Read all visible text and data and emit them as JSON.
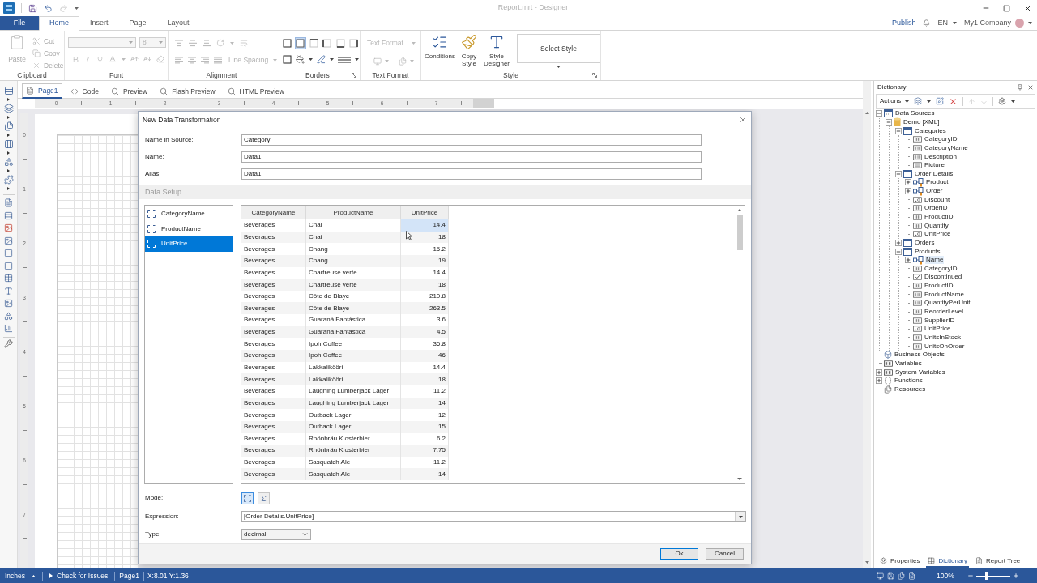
{
  "window": {
    "title": "Report.mrt - Designer"
  },
  "ribbon_tabs": [
    {
      "label": "File",
      "kind": "file",
      "selected": false
    },
    {
      "label": "Home",
      "kind": "tab",
      "selected": true
    },
    {
      "label": "Insert",
      "kind": "tab",
      "selected": false
    },
    {
      "label": "Page",
      "kind": "tab",
      "selected": false
    },
    {
      "label": "Layout",
      "kind": "tab",
      "selected": false
    }
  ],
  "account": {
    "publish": "Publish",
    "language": "EN",
    "company": "My1 Company"
  },
  "ribbon": {
    "clipboard": {
      "label": "Clipboard",
      "paste": {
        "label": "Paste",
        "disabled": true
      },
      "items": [
        {
          "label": "Cut",
          "kind": "cut",
          "disabled": true
        },
        {
          "label": "Copy",
          "kind": "copy",
          "disabled": true
        },
        {
          "label": "Delete",
          "kind": "delete",
          "disabled": true
        }
      ]
    },
    "font": {
      "label": "Font",
      "size": "8",
      "disabled": true
    },
    "alignment": {
      "label": "Alignment",
      "line_spacing": "Line Spacing",
      "disabled": true
    },
    "borders": {
      "label": "Borders",
      "buttons": [
        {
          "kind": "all",
          "selected": false
        },
        {
          "kind": "none",
          "selected": true
        },
        {
          "kind": "top",
          "selected": false
        },
        {
          "kind": "left",
          "selected": false
        },
        {
          "kind": "bottom",
          "selected": false
        },
        {
          "kind": "right",
          "selected": false
        }
      ]
    },
    "text_format": {
      "label": "Text Format",
      "format": "Text Format",
      "disabled": true
    },
    "style": {
      "label": "Style",
      "buttons": [
        {
          "label": "Conditions",
          "kind": "conditions"
        },
        {
          "label": "Copy Style",
          "kind": "copy"
        },
        {
          "label": "Style Designer",
          "kind": "designer"
        }
      ],
      "select": "Select Style"
    }
  },
  "doc_tabs": [
    {
      "label": "Page1",
      "kind": "page",
      "selected": true
    },
    {
      "label": "Code",
      "kind": "code",
      "selected": false
    },
    {
      "label": "Preview",
      "kind": "preview",
      "selected": false
    },
    {
      "label": "Flash Preview",
      "kind": "preview",
      "selected": false
    },
    {
      "label": "HTML Preview",
      "kind": "preview",
      "selected": false
    }
  ],
  "ruler": {
    "horizontal": [
      "0",
      "1",
      "2",
      "3",
      "4",
      "5",
      "6",
      "7"
    ],
    "vertical": [
      "0",
      "1",
      "2",
      "3",
      "4",
      "5",
      "6",
      "7"
    ]
  },
  "dialog": {
    "title": "New Data Transformation",
    "fields": [
      {
        "label": "Name in Source:",
        "value": "Category"
      },
      {
        "label": "Name:",
        "value": "Data1"
      },
      {
        "label": "Alias:",
        "value": "Data1"
      }
    ],
    "section": "Data Setup",
    "columns": [
      {
        "label": "CategoryName",
        "selected": false
      },
      {
        "label": "ProductName",
        "selected": false
      },
      {
        "label": "UnitPrice",
        "selected": true
      }
    ],
    "grid": {
      "columns": [
        "CategoryName",
        "ProductName",
        "UnitPrice"
      ],
      "rows": [
        {
          "cells": [
            "Beverages",
            "Chai",
            "14.4"
          ],
          "selected": true
        },
        {
          "cells": [
            "Beverages",
            "Chai",
            "18"
          ],
          "selected": false
        },
        {
          "cells": [
            "Beverages",
            "Chang",
            "15.2"
          ],
          "selected": false
        },
        {
          "cells": [
            "Beverages",
            "Chang",
            "19"
          ],
          "selected": false
        },
        {
          "cells": [
            "Beverages",
            "Chartreuse verte",
            "14.4"
          ],
          "selected": false
        },
        {
          "cells": [
            "Beverages",
            "Chartreuse verte",
            "18"
          ],
          "selected": false
        },
        {
          "cells": [
            "Beverages",
            "Côte de Blaye",
            "210.8"
          ],
          "selected": false
        },
        {
          "cells": [
            "Beverages",
            "Côte de Blaye",
            "263.5"
          ],
          "selected": false
        },
        {
          "cells": [
            "Beverages",
            "Guaraná Fantástica",
            "3.6"
          ],
          "selected": false
        },
        {
          "cells": [
            "Beverages",
            "Guaraná Fantástica",
            "4.5"
          ],
          "selected": false
        },
        {
          "cells": [
            "Beverages",
            "Ipoh Coffee",
            "36.8"
          ],
          "selected": false
        },
        {
          "cells": [
            "Beverages",
            "Ipoh Coffee",
            "46"
          ],
          "selected": false
        },
        {
          "cells": [
            "Beverages",
            "Lakkalikööri",
            "14.4"
          ],
          "selected": false
        },
        {
          "cells": [
            "Beverages",
            "Lakkalikööri",
            "18"
          ],
          "selected": false
        },
        {
          "cells": [
            "Beverages",
            "Laughing Lumberjack Lager",
            "11.2"
          ],
          "selected": false
        },
        {
          "cells": [
            "Beverages",
            "Laughing Lumberjack Lager",
            "14"
          ],
          "selected": false
        },
        {
          "cells": [
            "Beverages",
            "Outback Lager",
            "12"
          ],
          "selected": false
        },
        {
          "cells": [
            "Beverages",
            "Outback Lager",
            "15"
          ],
          "selected": false
        },
        {
          "cells": [
            "Beverages",
            "Rhönbräu Klosterbier",
            "6.2"
          ],
          "selected": false
        },
        {
          "cells": [
            "Beverages",
            "Rhönbräu Klosterbier",
            "7.75"
          ],
          "selected": false
        },
        {
          "cells": [
            "Beverages",
            "Sasquatch Ale",
            "11.2"
          ],
          "selected": false
        },
        {
          "cells": [
            "Beverages",
            "Sasquatch Ale",
            "14"
          ],
          "selected": false
        }
      ]
    },
    "mode": {
      "label": "Mode:",
      "options": [
        {
          "kind": "column",
          "selected": true
        },
        {
          "kind": "sum",
          "selected": false
        }
      ]
    },
    "expression": {
      "label": "Expression:",
      "value": "[Order Details.UnitPrice]"
    },
    "type": {
      "label": "Type:",
      "value": "decimal"
    },
    "buttons": [
      {
        "label": "Ok",
        "default": true
      },
      {
        "label": "Cancel",
        "default": false
      }
    ]
  },
  "dictionary": {
    "title": "Dictionary",
    "actions": "Actions",
    "tree": [
      {
        "label": "Data Sources",
        "kind": "datasources",
        "expanded": true,
        "selected": false,
        "children": [
          {
            "label": "Demo [XML]",
            "kind": "database",
            "expanded": true,
            "selected": false,
            "children": [
              {
                "label": "Categories",
                "kind": "table",
                "expanded": true,
                "selected": false,
                "children": [
                  {
                    "label": "CategoryID",
                    "kind": "int",
                    "selected": false
                  },
                  {
                    "label": "CategoryName",
                    "kind": "string",
                    "selected": false
                  },
                  {
                    "label": "Description",
                    "kind": "string",
                    "selected": false
                  },
                  {
                    "label": "Picture",
                    "kind": "picture",
                    "selected": false
                  }
                ]
              },
              {
                "label": "Order Details",
                "kind": "table",
                "expanded": true,
                "selected": false,
                "children": [
                  {
                    "label": "Product",
                    "kind": "relation",
                    "expanded": false,
                    "selected": false
                  },
                  {
                    "label": "Order",
                    "kind": "relation",
                    "expanded": false,
                    "selected": false
                  },
                  {
                    "label": "Discount",
                    "kind": "decimal",
                    "selected": false
                  },
                  {
                    "label": "OrderID",
                    "kind": "int",
                    "selected": false
                  },
                  {
                    "label": "ProductID",
                    "kind": "int",
                    "selected": false
                  },
                  {
                    "label": "Quantity",
                    "kind": "int",
                    "selected": false
                  },
                  {
                    "label": "UnitPrice",
                    "kind": "decimal",
                    "selected": false
                  }
                ]
              },
              {
                "label": "Orders",
                "kind": "table",
                "expanded": false,
                "selected": false
              },
              {
                "label": "Products",
                "kind": "table",
                "expanded": true,
                "selected": false,
                "children": [
                  {
                    "label": "Name",
                    "kind": "relation",
                    "expanded": false,
                    "selected": true
                  },
                  {
                    "label": "CategoryID",
                    "kind": "int",
                    "selected": false
                  },
                  {
                    "label": "Discontinued",
                    "kind": "bool",
                    "selected": false
                  },
                  {
                    "label": "ProductID",
                    "kind": "int",
                    "selected": false
                  },
                  {
                    "label": "ProductName",
                    "kind": "string",
                    "selected": false
                  },
                  {
                    "label": "QuantityPerUnit",
                    "kind": "string",
                    "selected": false
                  },
                  {
                    "label": "ReorderLevel",
                    "kind": "int",
                    "selected": false
                  },
                  {
                    "label": "SupplierID",
                    "kind": "int",
                    "selected": false
                  },
                  {
                    "label": "UnitPrice",
                    "kind": "decimal",
                    "selected": false
                  },
                  {
                    "label": "UnitsInStock",
                    "kind": "int",
                    "selected": false
                  },
                  {
                    "label": "UnitsOnOrder",
                    "kind": "int",
                    "selected": false
                  }
                ]
              }
            ]
          }
        ]
      },
      {
        "label": "Business Objects",
        "kind": "business",
        "selected": false
      },
      {
        "label": "Variables",
        "kind": "variables",
        "selected": false
      },
      {
        "label": "System Variables",
        "kind": "sysvars",
        "expanded": false,
        "selected": false
      },
      {
        "label": "Functions",
        "kind": "functions",
        "expanded": false,
        "selected": false
      },
      {
        "label": "Resources",
        "kind": "resources",
        "selected": false
      }
    ],
    "tabs": [
      {
        "label": "Properties",
        "kind": "properties",
        "selected": false
      },
      {
        "label": "Dictionary",
        "kind": "dictionary",
        "selected": true
      },
      {
        "label": "Report Tree",
        "kind": "tree",
        "selected": false
      }
    ]
  },
  "status_bar": {
    "units": "Inches",
    "check": "Check for Issues",
    "page": "Page1",
    "position": "X:8.01 Y:1.36",
    "zoom": "100%",
    "zoom_slider": {
      "level": 0.27
    }
  }
}
